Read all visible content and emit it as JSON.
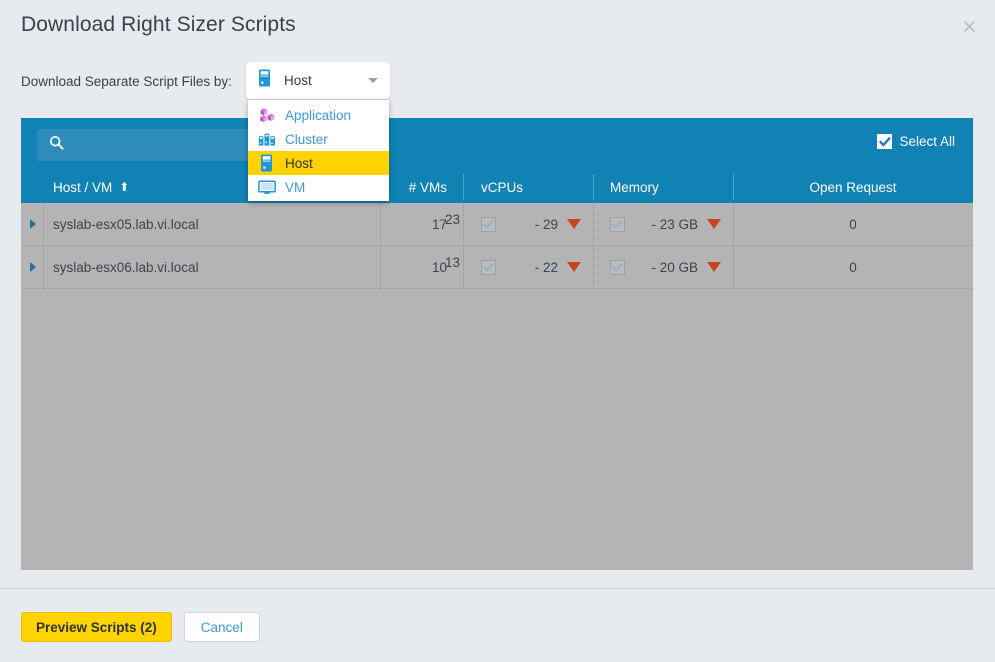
{
  "dialog": {
    "title": "Download Right Sizer Scripts",
    "close_icon": "close-icon"
  },
  "selector": {
    "label": "Download Separate Script Files by:",
    "selected_value": "Host",
    "selected_icon": "host-icon",
    "chevron_icon": "chevron-down-icon",
    "options": [
      {
        "label": "Application",
        "icon": "application-icon",
        "selected": false
      },
      {
        "label": "Cluster",
        "icon": "cluster-icon",
        "selected": false
      },
      {
        "label": "Host",
        "icon": "host-icon",
        "selected": true
      },
      {
        "label": "VM",
        "icon": "vm-icon",
        "selected": false
      }
    ]
  },
  "table": {
    "search": {
      "icon": "search-icon",
      "value": "",
      "placeholder": ""
    },
    "select_all": {
      "label": "Select All",
      "checked": true,
      "icon": "checkbox-checked-icon"
    },
    "columns": [
      {
        "key": "expand",
        "label": ""
      },
      {
        "key": "name",
        "label": "Host / VM",
        "sort": "asc",
        "sort_icon": "sort-ascending-icon"
      },
      {
        "key": "vms",
        "label": "# VMs"
      },
      {
        "key": "vcpus",
        "label": "vCPUs"
      },
      {
        "key": "memory",
        "label": "Memory"
      },
      {
        "key": "open_request",
        "label": "Open Request"
      }
    ],
    "rows": [
      {
        "name": "syslab-esx05.lab.vi.local",
        "vms": "17",
        "vcpus_checked": true,
        "vcpus_delta": "- 29",
        "vcpus_trend": "trend-down-icon",
        "memory_checked": true,
        "memory_delta": "- 23 GB",
        "memory_trend": "trend-down-icon",
        "open_request": "0"
      },
      {
        "name": "syslab-esx06.lab.vi.local",
        "vms": "10",
        "vcpus_checked": true,
        "vcpus_delta": "- 22",
        "vcpus_trend": "trend-down-icon",
        "memory_checked": true,
        "memory_delta": "- 20 GB",
        "memory_trend": "trend-down-icon",
        "open_request": "0"
      }
    ],
    "row_vcpus_counts": [
      "23",
      "13"
    ]
  },
  "footer": {
    "primary_label": "Preview Scripts (2)",
    "secondary_label": "Cancel"
  },
  "colors": {
    "header_blue": "#1082b4",
    "search_blue": "#2d8cb9",
    "body_grey": "#b4b4b4",
    "page_bg": "#e7eaee",
    "accent_yellow": "#ffd400",
    "highlight_yellow": "#ffd200",
    "link_blue": "#3b9ad9",
    "trend_red": "#c8431d"
  }
}
